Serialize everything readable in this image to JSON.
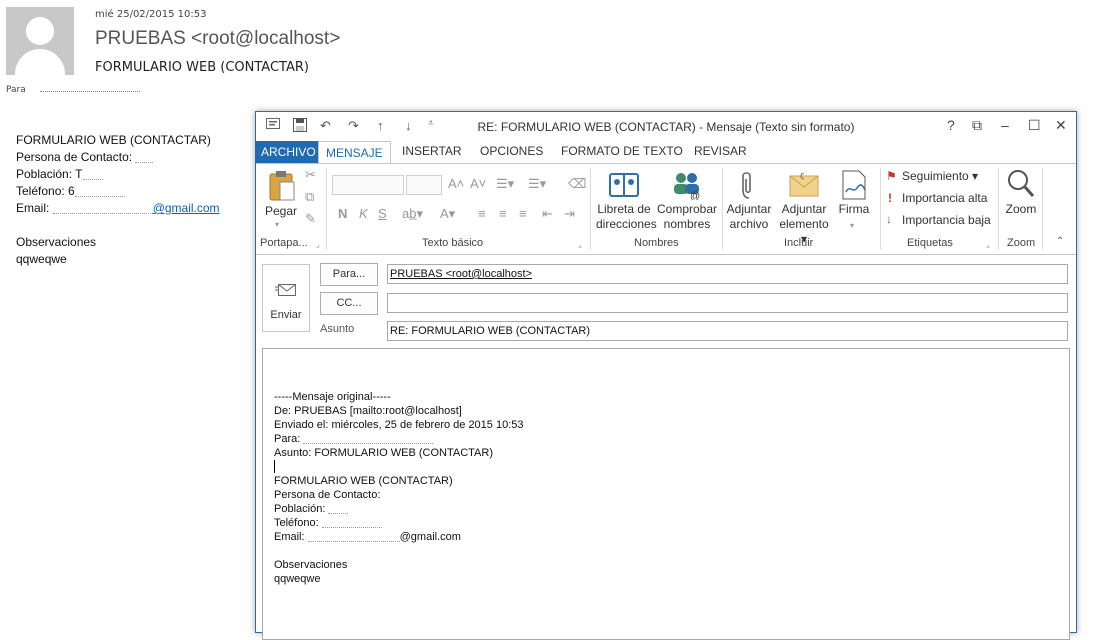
{
  "reading_pane": {
    "date": "mié 25/02/2015 10:53",
    "from": "PRUEBAS <root@localhost>",
    "subject": "FORMULARIO WEB (CONTACTAR)",
    "to_label": "Para",
    "body": {
      "heading": "FORMULARIO WEB (CONTACTAR)",
      "contact_label": "Persona de Contacto: ",
      "poblacion_label": "Población: T",
      "telefono_label": "Teléfono: 6",
      "email_label": "Email: ",
      "email_domain": "@gmail.com",
      "observaciones_label": "Observaciones",
      "observaciones_value": "qqweqwe"
    }
  },
  "compose": {
    "title": "RE: FORMULARIO WEB (CONTACTAR) - Mensaje (Texto sin formato)",
    "window_controls": {
      "help": "?",
      "restore": "⧉",
      "minimize": "–",
      "maximize": "☐",
      "close": "✕"
    },
    "tabs": [
      "ARCHIVO",
      "MENSAJE",
      "INSERTAR",
      "OPCIONES",
      "FORMATO DE TEXTO",
      "REVISAR"
    ],
    "active_tab": "MENSAJE",
    "ribbon": {
      "portapapeles": {
        "label": "Portapa...",
        "pegar": "Pegar"
      },
      "texto_basico": {
        "label": "Texto básico",
        "bold": "N",
        "italic": "K",
        "underline": "S"
      },
      "nombres": {
        "label": "Nombres",
        "libreta": [
          "Libreta de",
          "direcciones"
        ],
        "comprobar": [
          "Comprobar",
          "nombres"
        ]
      },
      "incluir": {
        "label": "Incluir",
        "adjuntar_archivo": [
          "Adjuntar",
          "archivo"
        ],
        "adjuntar_elemento": [
          "Adjuntar",
          "elemento ▾"
        ],
        "firma": "Firma"
      },
      "etiquetas": {
        "label": "Etiquetas",
        "seguimiento": "Seguimiento ▾",
        "importancia_alta": "Importancia alta",
        "importancia_baja": "Importancia baja"
      },
      "zoom": {
        "label": "Zoom",
        "button": "Zoom"
      }
    },
    "send_label": "Enviar",
    "para_button": "Para...",
    "cc_button": "CC...",
    "asunto_label": "Asunto",
    "to_value": "PRUEBAS <root@localhost>",
    "cc_value": "",
    "subject_value": "RE: FORMULARIO WEB (CONTACTAR)",
    "body_lines": [
      "-----Mensaje original-----",
      "De: PRUEBAS [mailto:root@localhost]",
      "Enviado el: miércoles, 25 de febrero de 2015 10:53",
      "Para: ",
      "Asunto: FORMULARIO WEB (CONTACTAR)",
      "",
      "FORMULARIO WEB (CONTACTAR)",
      "Persona de Contacto:",
      "Población: ",
      "Teléfono: ",
      "Email: ",
      "",
      "Observaciones",
      "qqweqwe"
    ],
    "body_email_suffix": "@gmail.com"
  },
  "colors": {
    "accent": "#1f6ab1",
    "link": "#0563c1"
  }
}
